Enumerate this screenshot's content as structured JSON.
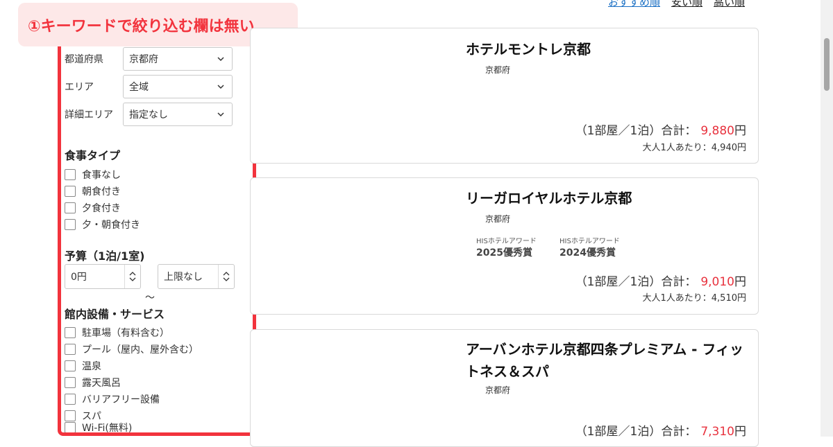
{
  "sort": {
    "recommended": "おすすめ順",
    "cheap": "安い順",
    "expensive": "高い順"
  },
  "callout": {
    "text": "①キーワードで絞り込む欄は無い"
  },
  "filters": {
    "prefecture": {
      "label": "都道府県",
      "value": "京都府"
    },
    "area": {
      "label": "エリア",
      "value": "全域"
    },
    "detail_area": {
      "label": "詳細エリア",
      "value": "指定なし"
    },
    "meal": {
      "title": "食事タイプ",
      "options": [
        "食事なし",
        "朝食付き",
        "夕食付き",
        "夕・朝食付き"
      ]
    },
    "budget": {
      "title": "予算（1泊/1室)",
      "min": "0円",
      "separator": "～",
      "max": "上限なし"
    },
    "facilities": {
      "title": "館内設備・サービス",
      "options": [
        "駐車場（有料含む）",
        "プール（屋内、屋外含む）",
        "温泉",
        "露天風呂",
        "バリアフリー設備",
        "スパ",
        "Wi-Fi(無料)"
      ]
    }
  },
  "hotels": [
    {
      "name": "ホテルモントレ京都",
      "prefecture": "京都府",
      "price_prefix": "（1部屋／1泊）合計：",
      "price": "9,880",
      "yen": "円",
      "per_person": "大人1人あたり：4,940円"
    },
    {
      "name": "リーガロイヤルホテル京都",
      "prefecture": "京都府",
      "awards": [
        {
          "label": "HISホテルアワード",
          "name": "2025優秀賞"
        },
        {
          "label": "HISホテルアワード",
          "name": "2024優秀賞"
        }
      ],
      "price_prefix": "（1部屋／1泊）合計：",
      "price": "9,010",
      "yen": "円",
      "per_person": "大人1人あたり：4,510円"
    },
    {
      "name_line1": "アーバンホテル京都四条プレミアム - フィッ",
      "name_line2": "トネス＆スパ",
      "prefecture": "京都府",
      "price_prefix": "（1部屋／1泊）合計：",
      "price": "7,310",
      "yen": "円"
    }
  ]
}
